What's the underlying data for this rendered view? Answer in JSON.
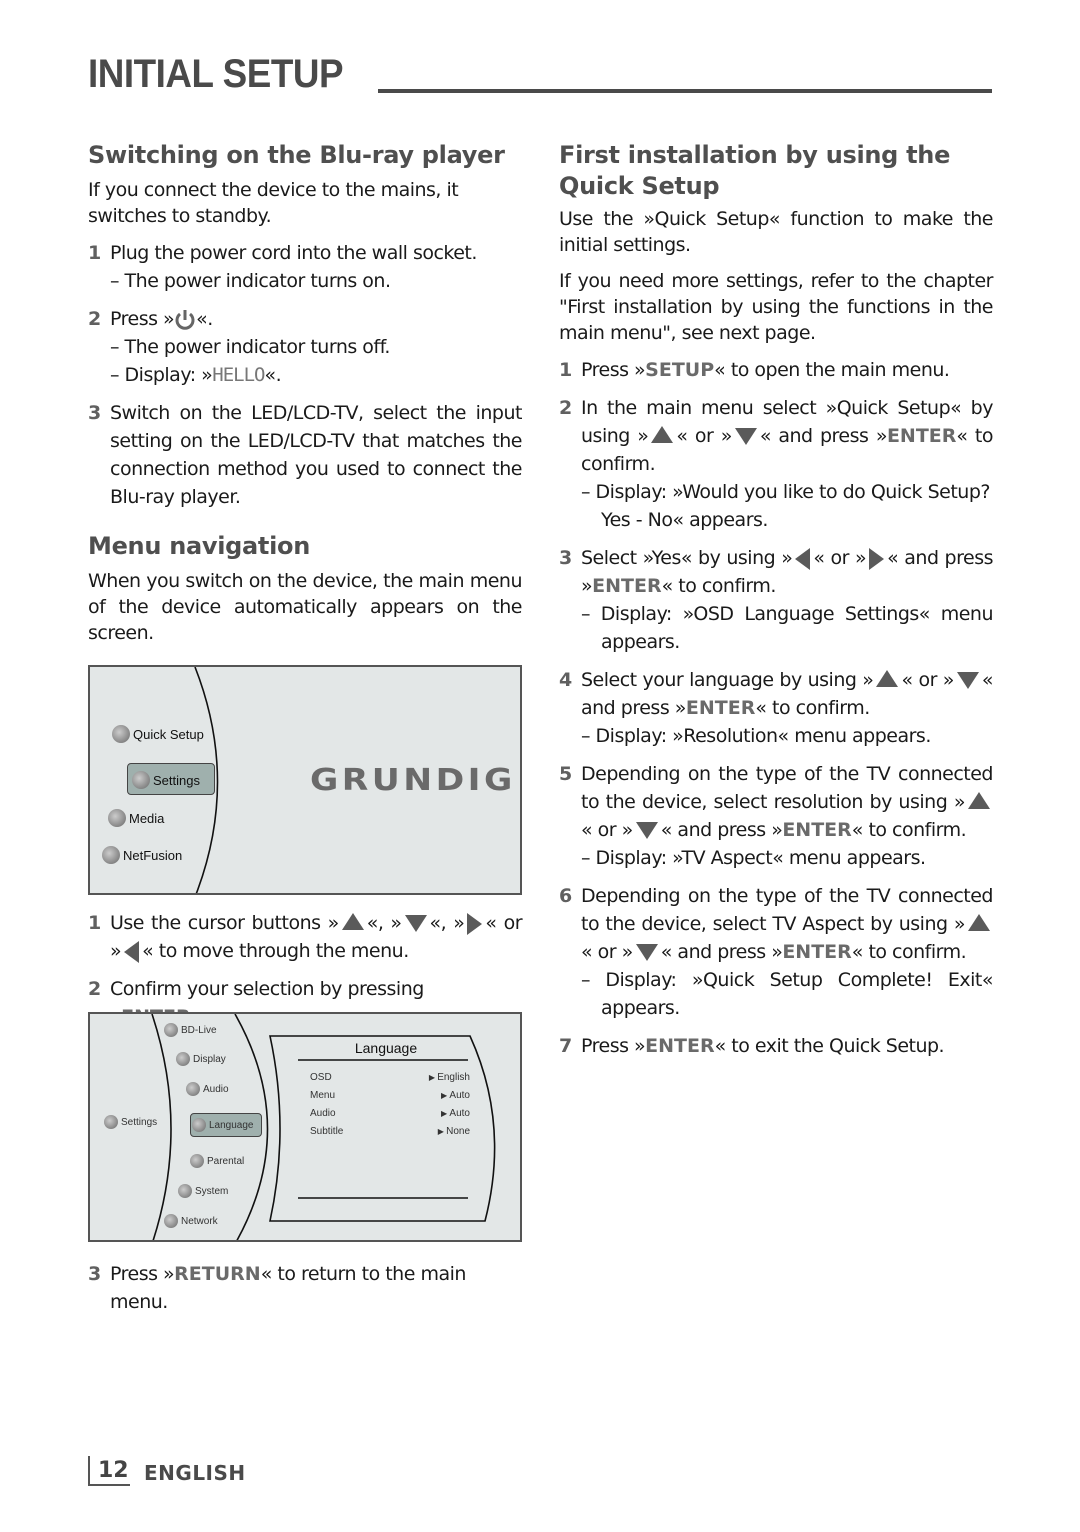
{
  "page": {
    "title": "INITIAL SETUP",
    "page_number": "12",
    "language": "ENGLISH"
  },
  "left": {
    "switching": {
      "heading": "Switching on the Blu-ray player",
      "intro": "If you connect the device to the mains, it switches to standby.",
      "step1_num": "1",
      "step1": "Plug the power cord into the wall socket.",
      "step1_sub": "– The power indicator turns on.",
      "step2_num": "2",
      "step2_pre": "Press »",
      "step2_post": "«.",
      "step2_sub1": "– The power indicator turns off.",
      "step2_sub2_pre": "– Display: »",
      "step2_sub2_lcd": "HELLO",
      "step2_sub2_post": "«.",
      "step3_num": "3",
      "step3": "Switch on the LED/LCD-TV, select the input setting on the LED/LCD-TV that matches the connection method you used to connect the Blu-ray player."
    },
    "menu_nav": {
      "heading": "Menu navigation",
      "intro": "When you switch on the device, the main menu of the device automatically appears on the screen.",
      "step1_num": "1",
      "step1_a": "Use the cursor buttons »",
      "step1_b": "«, »",
      "step1_c": "«, »",
      "step1_d": "« or »",
      "step1_e": "« to move through the menu.",
      "step2_num": "2",
      "step2_pre": "Confirm your selection by pressing »",
      "step2_key": "ENTER",
      "step2_post": "«.",
      "step3_num": "3",
      "step3_pre": "Press »",
      "step3_key": "RETURN",
      "step3_post": "« to return to the main menu."
    },
    "screen_main": {
      "items": [
        "Quick Setup",
        "Settings",
        "Media",
        "NetFusion"
      ],
      "selected": "Settings",
      "brand": "GRUNDIG"
    },
    "screen_settings": {
      "root": "Settings",
      "items": [
        "BD-Live",
        "Display",
        "Audio",
        "Language",
        "Parental",
        "System",
        "Network"
      ],
      "selected": "Language",
      "panel_title": "Language",
      "rows": [
        {
          "label": "OSD",
          "value": "English"
        },
        {
          "label": "Menu",
          "value": "Auto"
        },
        {
          "label": "Audio",
          "value": "Auto"
        },
        {
          "label": "Subtitle",
          "value": "None"
        }
      ]
    }
  },
  "right": {
    "heading": "First installation by using the Quick Setup",
    "intro1": "Use the »Quick Setup« function to make the initial settings.",
    "intro2": "If you need more settings, refer to the chapter \"First installation by using the functions in the main menu\", see next page.",
    "s1_num": "1",
    "s1_pre": "Press »",
    "s1_key": "SETUP",
    "s1_post": "« to open the main menu.",
    "s2_num": "2",
    "s2_a": "In the main menu select »Quick Setup« by using »",
    "s2_b": "« or »",
    "s2_c": "« and press »",
    "s2_key": "ENTER",
    "s2_d": "« to confirm.",
    "s2_sub": "– Display: »Would you like to do Quick Setup? Yes - No« appears.",
    "s3_num": "3",
    "s3_a": "Select »Yes« by using »",
    "s3_b": "« or »",
    "s3_c": "« and press »",
    "s3_key": "ENTER",
    "s3_d": "« to confirm.",
    "s3_sub": "– Display: »OSD Language Settings« menu appears.",
    "s4_num": "4",
    "s4_a": "Select your language by using »",
    "s4_b": "« or »",
    "s4_c": "« and press »",
    "s4_key": "ENTER",
    "s4_d": "« to confirm.",
    "s4_sub": "– Display: »Resolution« menu appears.",
    "s5_num": "5",
    "s5_a": "Depending on the type of the TV connected to the device, select resolution by using »",
    "s5_b": "« or »",
    "s5_c": "« and press »",
    "s5_key": "ENTER",
    "s5_d": "« to confirm.",
    "s5_sub": "– Display: »TV Aspect« menu appears.",
    "s6_num": "6",
    "s6_a": "Depending on the type of the TV connected to the device, select TV Aspect by using »",
    "s6_b": "« or »",
    "s6_c": "« and press »",
    "s6_key": "ENTER",
    "s6_d": "« to confirm.",
    "s6_sub": "– Display: »Quick Setup Complete! Exit« appears.",
    "s7_num": "7",
    "s7_pre": "Press »",
    "s7_key": "ENTER",
    "s7_post": "« to exit the Quick Setup."
  }
}
